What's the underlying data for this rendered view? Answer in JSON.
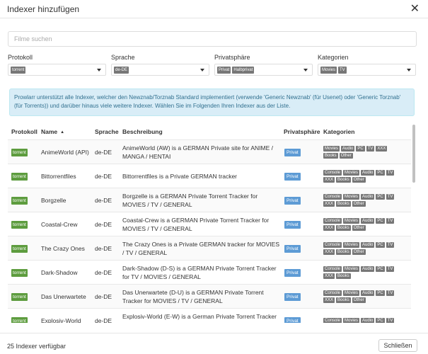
{
  "dialog": {
    "title": "Indexer hinzufügen",
    "close_icon": "close-icon"
  },
  "search": {
    "placeholder": "Filme suchen",
    "value": ""
  },
  "filters": [
    {
      "label": "Protokoll",
      "selected": [
        "torrent"
      ]
    },
    {
      "label": "Sprache",
      "selected": [
        "de-DE"
      ]
    },
    {
      "label": "Privatsphäre",
      "selected": [
        "Privat",
        "Halbprivat"
      ]
    },
    {
      "label": "Kategorien",
      "selected": [
        "Movies",
        "TV"
      ]
    }
  ],
  "info_text": "Prowlarr unterstützt alle Indexer, welcher den Newznab/Torznab Standard implementiert (verwende 'Generic Newznab' (für Usenet) oder 'Generic Torznab' (für Torrents)) und darüber hinaus viele weitere Indexer. Wählen Sie im Folgenden Ihren Indexer aus der Liste.",
  "table": {
    "columns": [
      "Protokoll",
      "Name",
      "Sprache",
      "Beschreibung",
      "Privatsphäre",
      "Kategorien"
    ],
    "sort_icon": "sort-ascending-icon",
    "rows": [
      {
        "protocol": "torrent",
        "name": "AnimeWorld (API)",
        "language": "de-DE",
        "description": "AnimeWorld (AW) is a GERMAN Private site for ANIME / MANGA / HENTAI",
        "privacy": "Privat",
        "categories": [
          "Movies",
          "Audio",
          "PC",
          "TV",
          "XXX",
          "Books",
          "Other"
        ]
      },
      {
        "protocol": "torrent",
        "name": "Bittorrentfiles",
        "language": "de-DE",
        "description": "Bittorrentfiles is a Private GERMAN tracker",
        "privacy": "Privat",
        "categories": [
          "Console",
          "Movies",
          "Audio",
          "PC",
          "TV",
          "XXX",
          "Books",
          "Other"
        ]
      },
      {
        "protocol": "torrent",
        "name": "Borgzelle",
        "language": "de-DE",
        "description": "Borgzelle is a GERMAN Private Torrent Tracker for MOVIES / TV / GENERAL",
        "privacy": "Privat",
        "categories": [
          "Console",
          "Movies",
          "Audio",
          "PC",
          "TV",
          "XXX",
          "Books",
          "Other"
        ]
      },
      {
        "protocol": "torrent",
        "name": "Coastal-Crew",
        "language": "de-DE",
        "description": "Coastal-Crew is a GERMAN Private Torrent Tracker for MOVIES / TV / GENERAL",
        "privacy": "Privat",
        "categories": [
          "Console",
          "Movies",
          "Audio",
          "PC",
          "TV",
          "XXX",
          "Books",
          "Other"
        ]
      },
      {
        "protocol": "torrent",
        "name": "The Crazy Ones",
        "language": "de-DE",
        "description": "The Crazy Ones is a Private GERMAN tracker for MOVIES / TV / GENERAL",
        "privacy": "Privat",
        "categories": [
          "Console",
          "Movies",
          "Audio",
          "PC",
          "TV",
          "XXX",
          "Books",
          "Other"
        ]
      },
      {
        "protocol": "torrent",
        "name": "Dark-Shadow",
        "language": "de-DE",
        "description": "Dark-Shadow (D-S) is a GERMAN Private Torrent Tracker for TV / MOVIES / GENERAL",
        "privacy": "Privat",
        "categories": [
          "Console",
          "Movies",
          "Audio",
          "PC",
          "TV",
          "XXX",
          "Books"
        ]
      },
      {
        "protocol": "torrent",
        "name": "Das Unerwartete",
        "language": "de-DE",
        "description": "Das Unerwartete (D-U) is a GERMAN Private Torrent Tracker for MOVIES / TV / GENERAL",
        "privacy": "Privat",
        "categories": [
          "Console",
          "Movies",
          "Audio",
          "PC",
          "TV",
          "XXX",
          "Books",
          "Other"
        ]
      },
      {
        "protocol": "torrent",
        "name": "Explosiv-World",
        "language": "de-DE",
        "description": "Explosiv-World (E-W) is a German Private Torrent Tracker for",
        "privacy": "Privat",
        "categories": [
          "Console",
          "Movies",
          "Audio",
          "PC",
          "TV"
        ]
      }
    ]
  },
  "footer": {
    "count_text": "25 Indexer verfügbar",
    "close_label": "Schließen"
  }
}
